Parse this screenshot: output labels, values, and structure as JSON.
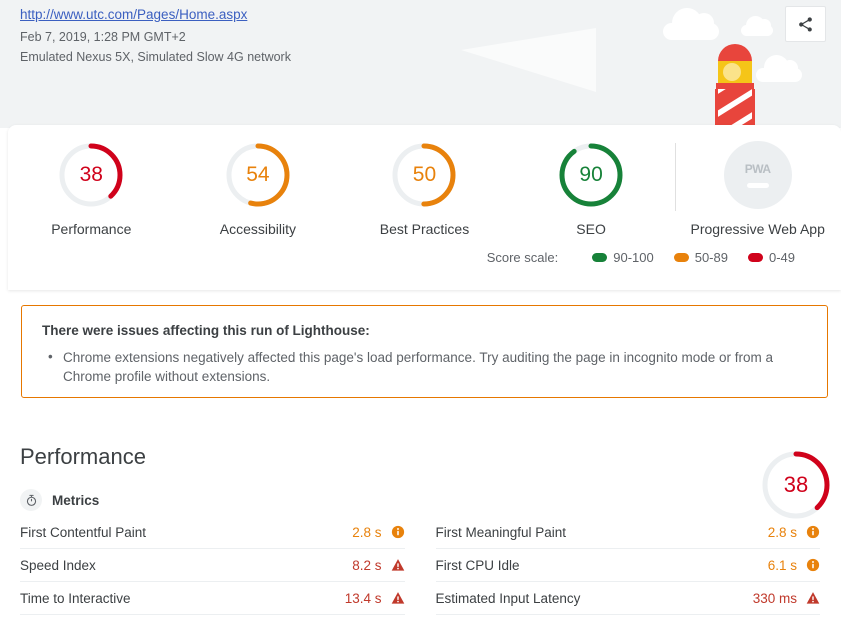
{
  "header": {
    "url": "http://www.utc.com/Pages/Home.aspx",
    "timestamp": "Feb 7, 2019, 1:28 PM GMT+2",
    "environment": "Emulated Nexus 5X, Simulated Slow 4G network",
    "share_icon": "share-icon",
    "lighthouse_icon": "lighthouse-illustration"
  },
  "scores": {
    "categories": [
      {
        "label": "Performance",
        "value": "38",
        "score": 38,
        "color": "#d0021b",
        "type": "gauge"
      },
      {
        "label": "Accessibility",
        "value": "54",
        "score": 54,
        "color": "#e8820c",
        "type": "gauge"
      },
      {
        "label": "Best Practices",
        "value": "50",
        "score": 50,
        "color": "#e8820c",
        "type": "gauge"
      },
      {
        "label": "SEO",
        "value": "90",
        "score": 90,
        "color": "#178239",
        "type": "gauge"
      },
      {
        "label": "Progressive Web App",
        "value": "PWA",
        "score": null,
        "color": "#b9bfc4",
        "type": "badge"
      }
    ],
    "scale_label": "Score scale:",
    "scale": [
      {
        "range": "90-100",
        "color": "#178239"
      },
      {
        "range": "50-89",
        "color": "#e8820c"
      },
      {
        "range": "0-49",
        "color": "#d0021b"
      }
    ]
  },
  "warning": {
    "title": "There were issues affecting this run of Lighthouse:",
    "items": [
      "Chrome extensions negatively affected this page's load performance. Try auditing the page in incognito mode or from a Chrome profile without extensions."
    ],
    "border_color": "#e67700"
  },
  "performance": {
    "title": "Performance",
    "score": "38",
    "score_value": 38,
    "score_color": "#d0021b",
    "metrics_heading": "Metrics",
    "metrics_icon": "stopwatch-icon",
    "left_column": [
      {
        "name": "First Contentful Paint",
        "value": "2.8 s",
        "status": "average",
        "color": "#e8820c",
        "icon": "info-circle-icon"
      },
      {
        "name": "Speed Index",
        "value": "8.2 s",
        "status": "poor",
        "color": "#c0392b",
        "icon": "warning-triangle-icon"
      },
      {
        "name": "Time to Interactive",
        "value": "13.4 s",
        "status": "poor",
        "color": "#c0392b",
        "icon": "warning-triangle-icon"
      }
    ],
    "right_column": [
      {
        "name": "First Meaningful Paint",
        "value": "2.8 s",
        "status": "average",
        "color": "#e8820c",
        "icon": "info-circle-icon"
      },
      {
        "name": "First CPU Idle",
        "value": "6.1 s",
        "status": "average",
        "color": "#e8820c",
        "icon": "info-circle-icon"
      },
      {
        "name": "Estimated Input Latency",
        "value": "330 ms",
        "status": "poor",
        "color": "#c0392b",
        "icon": "warning-triangle-icon"
      }
    ]
  }
}
